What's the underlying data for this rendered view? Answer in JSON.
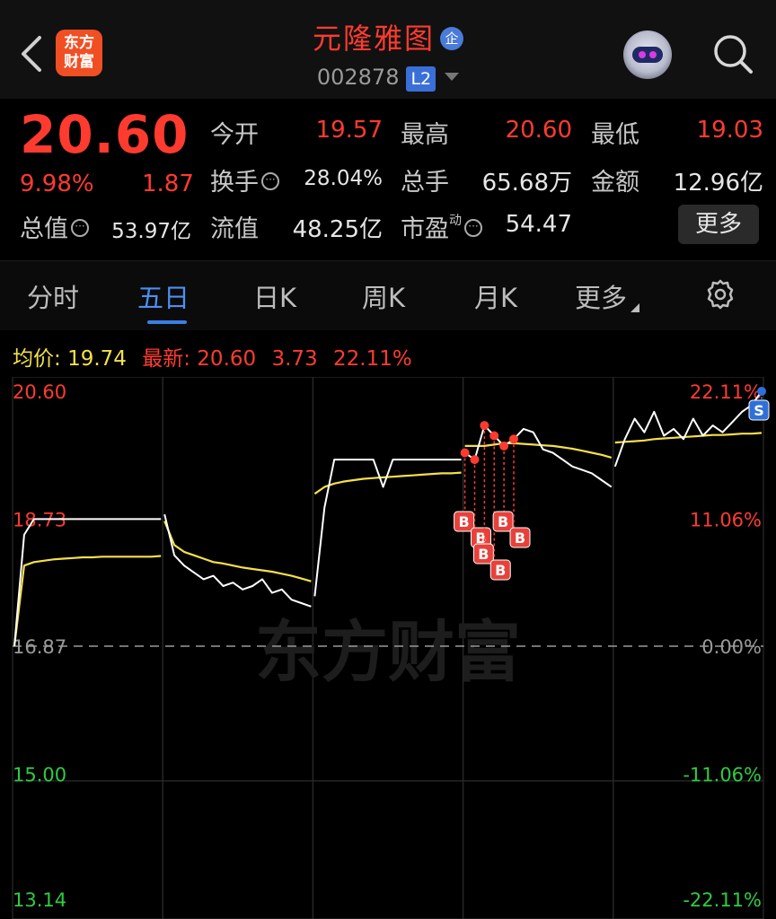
{
  "header": {
    "logo_text": "东方财富",
    "stock_name": "元隆雅图",
    "badge": "企",
    "code": "002878",
    "level_badge": "L2"
  },
  "quote": {
    "price": "20.60",
    "change_pct": "9.98%",
    "change": "1.87",
    "open_label": "今开",
    "open": "19.57",
    "high_label": "最高",
    "high": "20.60",
    "low_label": "最低",
    "low": "19.03",
    "turnover_label": "换手",
    "turnover": "28.04%",
    "volume_label": "总手",
    "volume": "65.68万",
    "amount_label": "金额",
    "amount": "12.96亿",
    "mktcap_label": "总值",
    "mktcap": "53.97亿",
    "float_label": "流值",
    "float_cap": "48.25亿",
    "pe_label": "市盈",
    "pe_sup": "动",
    "pe": "54.47",
    "more_label": "更多"
  },
  "tabs": [
    "分时",
    "五日",
    "日K",
    "周K",
    "月K",
    "更多"
  ],
  "active_tab": "五日",
  "legend": {
    "avg_label": "均价:",
    "avg": "19.74",
    "latest_label": "最新:",
    "latest": "20.60",
    "latest_chg": "3.73",
    "latest_pct": "22.11%"
  },
  "watermark": "东方财富",
  "colors": {
    "up": "#ff3b30",
    "down": "#2ecc40",
    "avg_line": "#f5e04a",
    "price_line": "#ffffff",
    "accent": "#3a7fe6"
  },
  "chart_data": {
    "type": "line",
    "title": "",
    "days": 5,
    "prev_close": 16.87,
    "ylim": [
      13.14,
      20.6
    ],
    "y_ticks_left": [
      "20.60",
      "18.73",
      "16.87",
      "15.00",
      "13.14"
    ],
    "y_ticks_right": [
      "22.11%",
      "11.06%",
      "0.00%",
      "-11.06%",
      "-22.11%"
    ],
    "series": [
      {
        "values": [
          [
            16.87,
            18.5,
            18.73,
            18.73,
            18.73,
            18.73,
            18.73,
            18.73,
            18.73,
            18.73,
            18.73,
            18.73,
            18.73,
            18.73,
            18.73,
            18.73
          ],
          [
            18.8,
            18.2,
            18.05,
            17.95,
            17.85,
            17.9,
            17.75,
            17.8,
            17.7,
            17.75,
            17.85,
            17.65,
            17.7,
            17.55,
            17.5,
            17.45
          ],
          [
            17.6,
            18.9,
            19.6,
            19.6,
            19.6,
            19.6,
            19.6,
            19.2,
            19.6,
            19.6,
            19.6,
            19.6,
            19.6,
            19.6,
            19.6,
            19.6
          ],
          [
            19.7,
            19.6,
            20.1,
            19.95,
            19.8,
            19.9,
            20.05,
            20.0,
            19.75,
            19.7,
            19.6,
            19.5,
            19.45,
            19.4,
            19.3,
            19.2
          ],
          [
            19.5,
            19.9,
            20.2,
            20.0,
            20.3,
            19.95,
            20.05,
            19.9,
            20.2,
            19.95,
            20.1,
            20.0,
            20.15,
            20.3,
            20.4,
            20.6
          ]
        ]
      },
      {
        "values": [
          [
            16.87,
            18.05,
            18.1,
            18.12,
            18.14,
            18.15,
            18.16,
            18.17,
            18.17,
            18.18,
            18.18,
            18.18,
            18.18,
            18.18,
            18.18,
            18.19
          ],
          [
            18.7,
            18.35,
            18.25,
            18.2,
            18.15,
            18.1,
            18.08,
            18.05,
            18.02,
            18.0,
            17.98,
            17.96,
            17.93,
            17.9,
            17.86,
            17.82
          ],
          [
            19.1,
            19.2,
            19.25,
            19.28,
            19.3,
            19.32,
            19.33,
            19.34,
            19.35,
            19.36,
            19.37,
            19.38,
            19.39,
            19.4,
            19.4,
            19.41
          ],
          [
            19.8,
            19.8,
            19.8,
            19.82,
            19.84,
            19.84,
            19.83,
            19.82,
            19.81,
            19.8,
            19.78,
            19.76,
            19.73,
            19.7,
            19.67,
            19.63
          ],
          [
            19.85,
            19.86,
            19.87,
            19.88,
            19.9,
            19.91,
            19.92,
            19.93,
            19.94,
            19.95,
            19.96,
            19.96,
            19.97,
            19.98,
            19.98,
            19.99
          ]
        ]
      }
    ],
    "trade_marks": [
      {
        "label": "B",
        "day": 4,
        "index": 0
      },
      {
        "label": "B",
        "day": 4,
        "index": 1
      },
      {
        "label": "B",
        "day": 4,
        "index": 2
      },
      {
        "label": "B",
        "day": 4,
        "index": 3
      },
      {
        "label": "B",
        "day": 4,
        "index": 4
      },
      {
        "label": "B",
        "day": 4,
        "index": 5
      },
      {
        "label": "S",
        "day": 5,
        "index": 15
      }
    ]
  }
}
